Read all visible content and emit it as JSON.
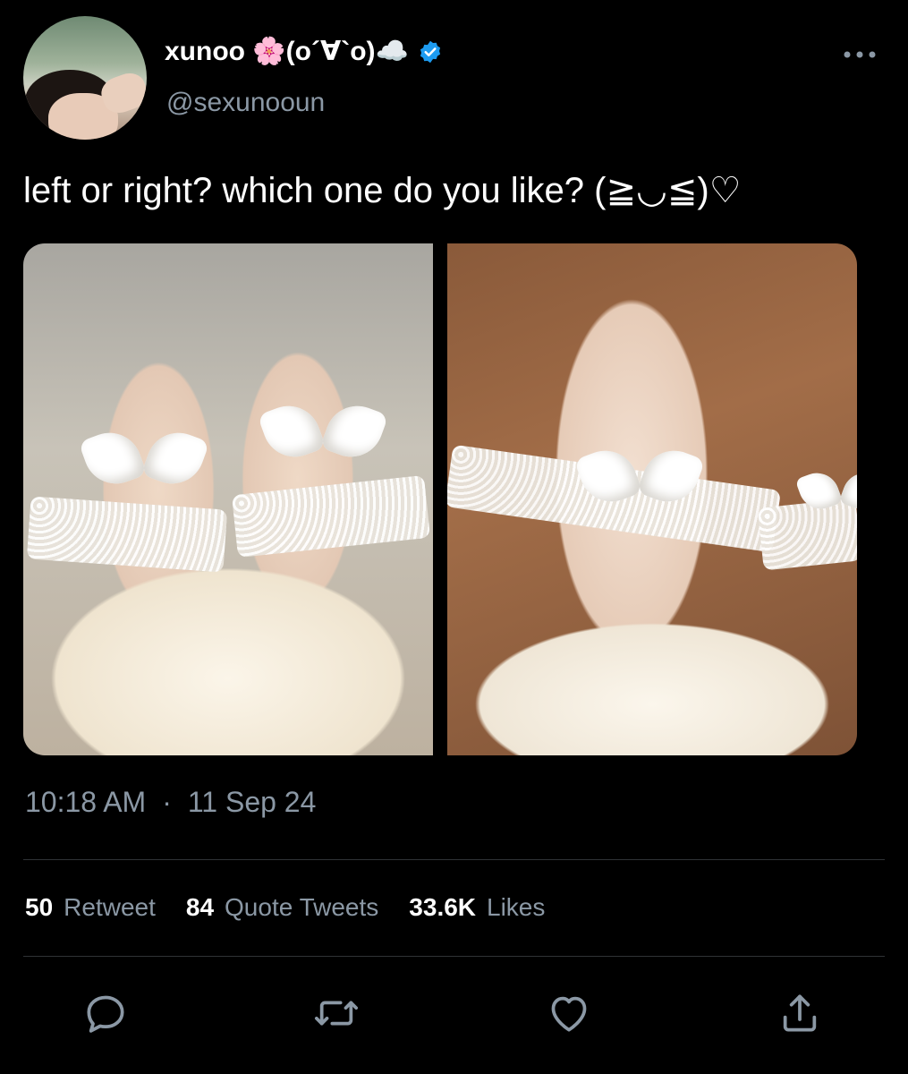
{
  "author": {
    "display_name": "xunoo 🌸(o´∀`o)☁️",
    "handle": "@sexunooun",
    "verified": true
  },
  "tweet": {
    "text": "left or right? which one do you like? (≧◡≦)♡"
  },
  "meta": {
    "time": "10:18 AM",
    "separator": "·",
    "date": "11 Sep 24"
  },
  "stats": [
    {
      "count": "50",
      "label": "Retweet"
    },
    {
      "count": "84",
      "label": "Quote Tweets"
    },
    {
      "count": "33.6K",
      "label": "Likes"
    }
  ],
  "icons": {
    "more": "more-horizontal-icon",
    "reply": "reply-icon",
    "retweet": "retweet-icon",
    "like": "heart-icon",
    "share": "share-icon"
  },
  "colors": {
    "background": "#000000",
    "primary_text": "#ffffff",
    "secondary_text": "#8b98a5",
    "verified": "#1d9bf0",
    "divider": "#2f3336"
  }
}
